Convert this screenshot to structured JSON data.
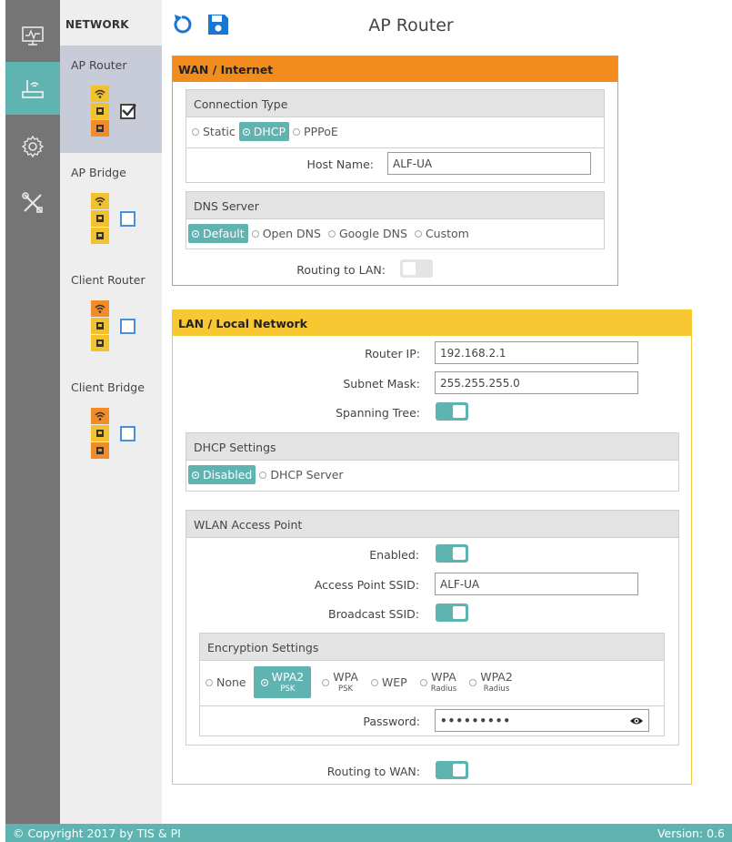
{
  "header": {
    "title": "AP Router",
    "reset_icon": "undo-icon",
    "save_icon": "save-icon"
  },
  "rail": {
    "items": [
      "monitor-icon",
      "router-icon",
      "gear-icon",
      "tools-icon"
    ],
    "active_index": 1
  },
  "network": {
    "title": "NETWORK",
    "modes": [
      {
        "label": "AP Router",
        "checked": true
      },
      {
        "label": "AP Bridge",
        "checked": false
      },
      {
        "label": "Client Router",
        "checked": false
      },
      {
        "label": "Client Bridge",
        "checked": false
      }
    ]
  },
  "wan": {
    "title": "WAN / Internet",
    "connection_type": {
      "title": "Connection Type",
      "options": [
        "Static",
        "DHCP",
        "PPPoE"
      ],
      "selected": "DHCP"
    },
    "host_name": {
      "label": "Host Name:",
      "value": "ALF-UA"
    },
    "dns": {
      "title": "DNS Server",
      "options": [
        "Default",
        "Open DNS",
        "Google DNS",
        "Custom"
      ],
      "selected": "Default"
    },
    "routing_to_lan": {
      "label": "Routing to LAN:",
      "on": false
    }
  },
  "lan": {
    "title": "LAN / Local Network",
    "router_ip": {
      "label": "Router IP:",
      "value": "192.168.2.1"
    },
    "subnet_mask": {
      "label": "Subnet Mask:",
      "value": "255.255.255.0"
    },
    "spanning_tree": {
      "label": "Spanning Tree:",
      "on": true
    },
    "dhcp": {
      "title": "DHCP Settings",
      "options": [
        "Disabled",
        "DHCP Server"
      ],
      "selected": "Disabled"
    },
    "wlan": {
      "title": "WLAN Access Point",
      "enabled": {
        "label": "Enabled:",
        "on": true
      },
      "ssid": {
        "label": "Access Point SSID:",
        "value": "ALF-UA"
      },
      "broadcast": {
        "label": "Broadcast SSID:",
        "on": true
      },
      "encryption": {
        "title": "Encryption Settings",
        "options": [
          {
            "main": "None",
            "sub": ""
          },
          {
            "main": "WPA2",
            "sub": "PSK"
          },
          {
            "main": "WPA",
            "sub": "PSK"
          },
          {
            "main": "WEP",
            "sub": ""
          },
          {
            "main": "WPA",
            "sub": "Radius"
          },
          {
            "main": "WPA2",
            "sub": "Radius"
          }
        ],
        "selected_index": 1
      },
      "password": {
        "label": "Password:",
        "value": "•••••••••",
        "toggle_icon": "eye-icon"
      }
    },
    "routing_to_wan": {
      "label": "Routing to WAN:",
      "on": true
    }
  },
  "footer": {
    "copyright": "© Copyright 2017 by TIS & PI",
    "version": "Version: 0.6"
  },
  "colors": {
    "accent": "#5fb3b0",
    "wan": "#f28c1c",
    "lan": "#f7c832",
    "rail": "#757575"
  }
}
